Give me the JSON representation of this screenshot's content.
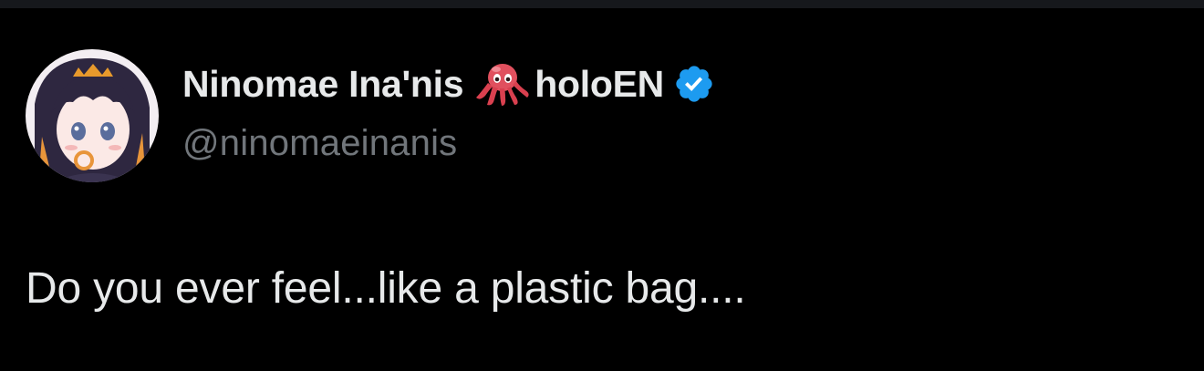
{
  "tweet": {
    "author": {
      "display_name": "Ninomae Ina'nis",
      "name_emoji": "octopus-emoji",
      "name_suffix": "holoEN",
      "verified_icon": "verified-badge-icon",
      "handle": "@ninomaeinanis"
    },
    "text": "Do you ever feel...like a plastic bag...."
  },
  "colors": {
    "background": "#000000",
    "primary_text": "#e7e9ea",
    "secondary_text": "#71767b",
    "verified_blue": "#1d9bf0",
    "octopus_red": "#e0505e"
  }
}
